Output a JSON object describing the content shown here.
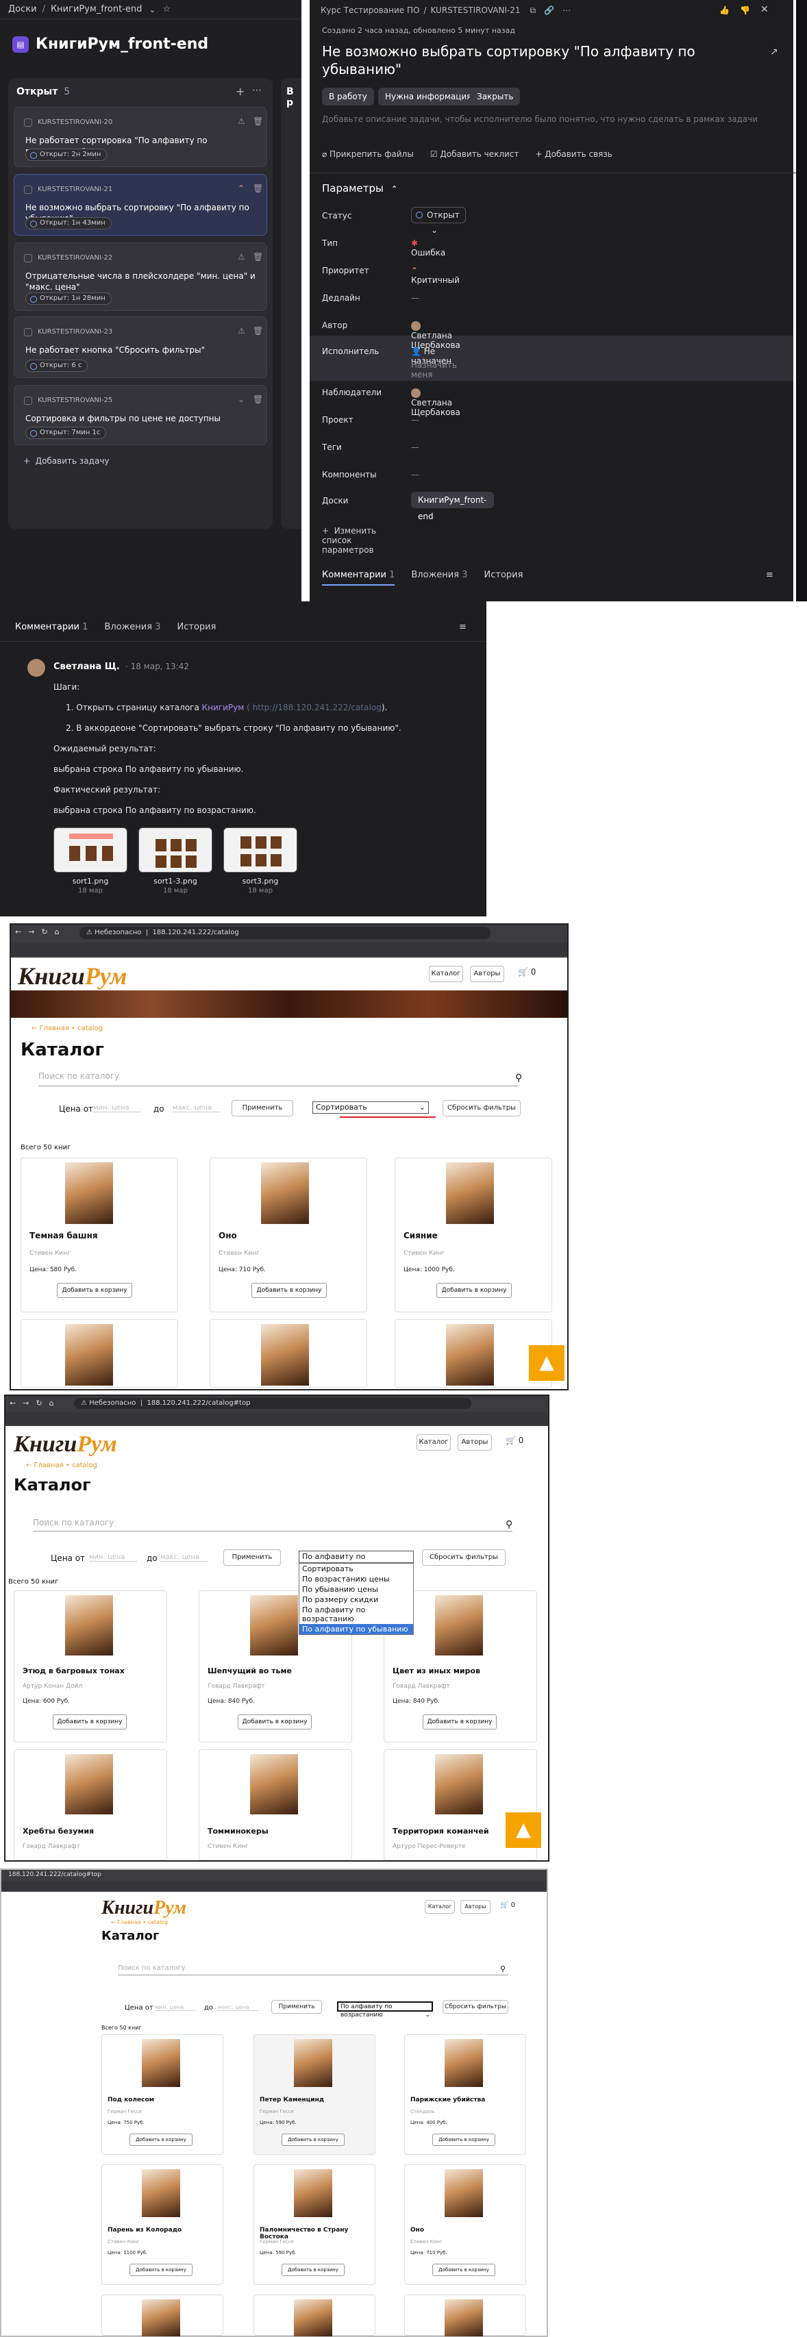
{
  "tracker": {
    "breadcrumb": [
      "Доски",
      "КнигиРум_front-end"
    ],
    "board_title": "КнигиРум_front-end",
    "column": {
      "name": "Открыт",
      "count": "5",
      "next_name": "В р"
    },
    "cards": [
      {
        "key": "KURSTESTIROVANI-20",
        "title": "Не работает сортировка \"По алфавиту по возрастанию\"",
        "status": "Открыт: 2н 2мин"
      },
      {
        "key": "KURSTESTIROVANI-21",
        "title": "Не возможно выбрать сортировку \"По алфавиту по убыванию\"",
        "status": "Открыт: 1н 43мин"
      },
      {
        "key": "KURSTESTIROVANI-22",
        "title": "Отрицательные числа в плейсхолдере \"мин. цена\" и \"макс. цена\"",
        "status": "Открыт: 1н 28мин"
      },
      {
        "key": "KURSTESTIROVANI-23",
        "title": "Не работает кнопка \"Сбросить фильтры\"",
        "status": "Открыт: 6 с"
      },
      {
        "key": "KURSTESTIROVANI-25",
        "title": "Сортировка и фильтры по цене не доступны",
        "status": "Открыт: 7мин 1с"
      }
    ],
    "add_task": "Добавить задачу",
    "issue": {
      "crumb": [
        "Курс Тестирование ПО",
        "KURSTESTIROVANI-21"
      ],
      "meta": "Создано 2 часа назад, обновлено 5 минут назад",
      "title": "Не возможно выбрать сортировку \"По алфавиту по убыванию\"",
      "actions": [
        "В работу",
        "Нужна информация",
        "Закрыть"
      ],
      "desc_placeholder": "Добавьте описание задачи, чтобы исполнителю было понятно, что нужно сделать в рамках задачи",
      "links": [
        "Прикрепить файлы",
        "Добавить чеклист",
        "Добавить связь"
      ],
      "params_title": "Параметры",
      "params": [
        {
          "label": "Статус",
          "value": "Открыт"
        },
        {
          "label": "Тип",
          "value": "Ошибка"
        },
        {
          "label": "Приоритет",
          "value": "Критичный"
        },
        {
          "label": "Дедлайн",
          "value": "—"
        },
        {
          "label": "Автор",
          "value": "Светлана Щербакова"
        },
        {
          "label": "Исполнитель",
          "value": "Не назначен",
          "extra": "Назначить меня"
        },
        {
          "label": "Наблюдатели",
          "value": "Светлана Щербакова"
        },
        {
          "label": "Проект",
          "value": "—"
        },
        {
          "label": "Теги",
          "value": "—"
        },
        {
          "label": "Компоненты",
          "value": "—"
        },
        {
          "label": "Доски",
          "value": "КнигиРум_front-end"
        }
      ],
      "change_params": "Изменить список параметров",
      "tabs": [
        {
          "label": "Комментарии",
          "count": "1"
        },
        {
          "label": "Вложения",
          "count": "3"
        },
        {
          "label": "История",
          "count": ""
        }
      ]
    }
  },
  "comments": {
    "tabs": [
      {
        "label": "Комментарии",
        "count": "1"
      },
      {
        "label": "Вложения",
        "count": "3"
      },
      {
        "label": "История",
        "count": ""
      }
    ],
    "author": "Светлана Щ.",
    "date": "· 18 мар, 13:42",
    "steps_title": "Шаги:",
    "step1_pre": "1. Открыть страницу каталога ",
    "step1_link": "КнигиРум",
    "step1_url": "( http://188.120.241.222/catalog",
    "step1_post": ").",
    "step2": "2. В аккордеоне \"Сортировать\" выбрать строку \"По алфавиту по убыванию\".",
    "expected_title": "Ожидаемый результат:",
    "expected": "выбрана строка По алфавиту по убыванию.",
    "actual_title": "Фактический результат:",
    "actual": "выбрана строка По алфавиту по возрастанию.",
    "attachments": [
      {
        "name": "sort1.png",
        "date": "18 мар"
      },
      {
        "name": "sort1-3.png",
        "date": "18 мар"
      },
      {
        "name": "sort3.png",
        "date": "18 мар"
      }
    ]
  },
  "shots": {
    "brand1": "Книги",
    "brand2": "Рум",
    "nav": [
      "Каталог",
      "Авторы"
    ],
    "cart_count": "0",
    "breadcrumb": "← Главная • catalog",
    "heading": "Каталог",
    "search_ph": "Поиск по каталогу",
    "price_from": "Цена от",
    "price_to": "до",
    "min_ph": "мин. цена",
    "max_ph": "макс. цена",
    "apply": "Применить",
    "reset": "Сбросить фильтры",
    "total": "Всего 50 книг",
    "add_cart": "Добавить в корзину",
    "shot1": {
      "url": "188.120.241.222/catalog",
      "insecure": "Небезопасно",
      "select": "Сортировать",
      "books": [
        {
          "t": "Темная башня",
          "a": "Стивен Кинг",
          "p": "Цена: 580 Руб."
        },
        {
          "t": "Оно",
          "a": "Стивен Кинг",
          "p": "Цена: 710 Руб."
        },
        {
          "t": "Сияние",
          "a": "Стивен Кинг",
          "p": "Цена: 1000 Руб."
        }
      ]
    },
    "shot2": {
      "url": "188.120.241.222/catalog#top",
      "insecure": "Небезопасно",
      "select": "По алфавиту по возрастанию",
      "options": [
        "Сортировать",
        "По возрастанию цены",
        "По убыванию цены",
        "По размеру скидки",
        "По алфавиту по возрастанию",
        "По алфавиту по убыванию"
      ],
      "books": [
        {
          "t": "Этюд в багровых тонах",
          "a": "Артур Конан Дойл",
          "p": "Цена: 600 Руб."
        },
        {
          "t": "Шепчущий во тьме",
          "a": "Говард Лавкрафт",
          "p": "Цена: 840 Руб."
        },
        {
          "t": "Цвет из иных миров",
          "a": "Говард Лавкрафт",
          "p": "Цена: 840 Руб."
        },
        {
          "t": "Хребты безумия",
          "a": "Говард Лавкрафт",
          "p": ""
        },
        {
          "t": "Томминокеры",
          "a": "Стивен Кинг",
          "p": ""
        },
        {
          "t": "Территория команчей",
          "a": "Артуро Перес-Реверте",
          "p": ""
        }
      ]
    },
    "shot3": {
      "url": "188.120.241.222/catalog#top",
      "select": "По алфавиту по возрастанию",
      "total": "Всего 50 книг",
      "books": [
        {
          "t": "Под колесом",
          "a": "Герман Гессе",
          "p": "Цена: 750 Руб."
        },
        {
          "t": "Петер Каменцинд",
          "a": "Герман Гессе",
          "p": "Цена: 590 Руб."
        },
        {
          "t": "Парижские убийства",
          "a": "Стендаль",
          "p": "Цена: 400 Руб."
        },
        {
          "t": "Парень из Колорадо",
          "a": "Стивен Кинг",
          "p": "Цена: 1100 Руб."
        },
        {
          "t": "Паломничество в Страну Востока",
          "a": "Герман Гессе",
          "p": "Цена: 590 Руб."
        },
        {
          "t": "Оно",
          "a": "Стивен Кинг",
          "p": "Цена: 710 Руб."
        }
      ]
    }
  }
}
